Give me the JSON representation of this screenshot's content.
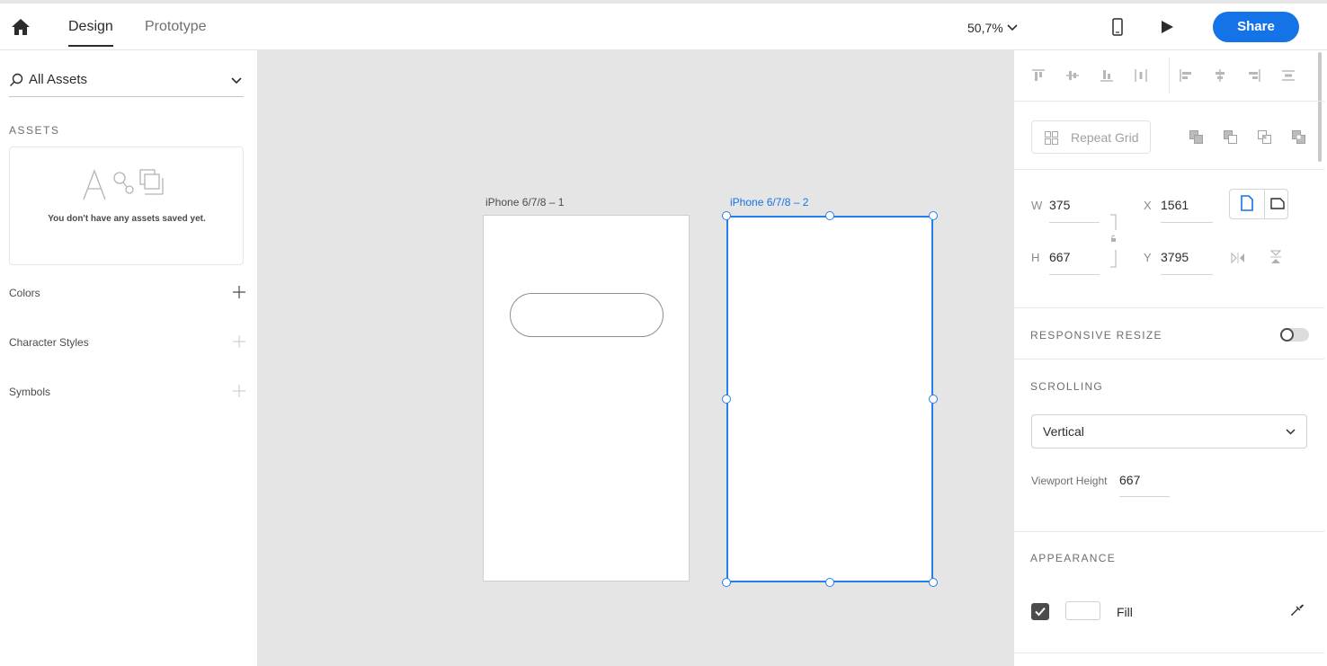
{
  "topbar": {
    "tabs": [
      "Design",
      "Prototype"
    ],
    "zoom": "50,7%",
    "share_label": "Share"
  },
  "left_panel": {
    "search_label": "All Assets",
    "assets_heading": "ASSETS",
    "assets_empty": "You don't have any assets saved yet.",
    "rows": [
      "Colors",
      "Character Styles",
      "Symbols"
    ]
  },
  "canvas": {
    "artboards": [
      "iPhone 6/7/8 – 1",
      "iPhone 6/7/8 – 2"
    ]
  },
  "right_panel": {
    "repeat_grid_label": "Repeat Grid",
    "w_key": "W",
    "w_val": "375",
    "h_key": "H",
    "h_val": "667",
    "x_key": "X",
    "x_val": "1561",
    "y_key": "Y",
    "y_val": "3795",
    "responsive_resize": "RESPONSIVE RESIZE",
    "responsive_resize_on": false,
    "scrolling": "SCROLLING",
    "scrolling_value": "Vertical",
    "viewport_height_label": "Viewport Height",
    "viewport_height_value": "667",
    "appearance": "APPEARANCE",
    "fill_label": "Fill",
    "fill_checked": true
  },
  "colors": {
    "accent": "#1473e6",
    "selection": "#2680eb",
    "canvas": "#e5e5e5"
  },
  "icons": [
    "home-icon",
    "chevron-down-icon",
    "device-preview-icon",
    "play-icon",
    "search-icon",
    "plus-icon",
    "lock-icon",
    "eyedropper-icon"
  ]
}
